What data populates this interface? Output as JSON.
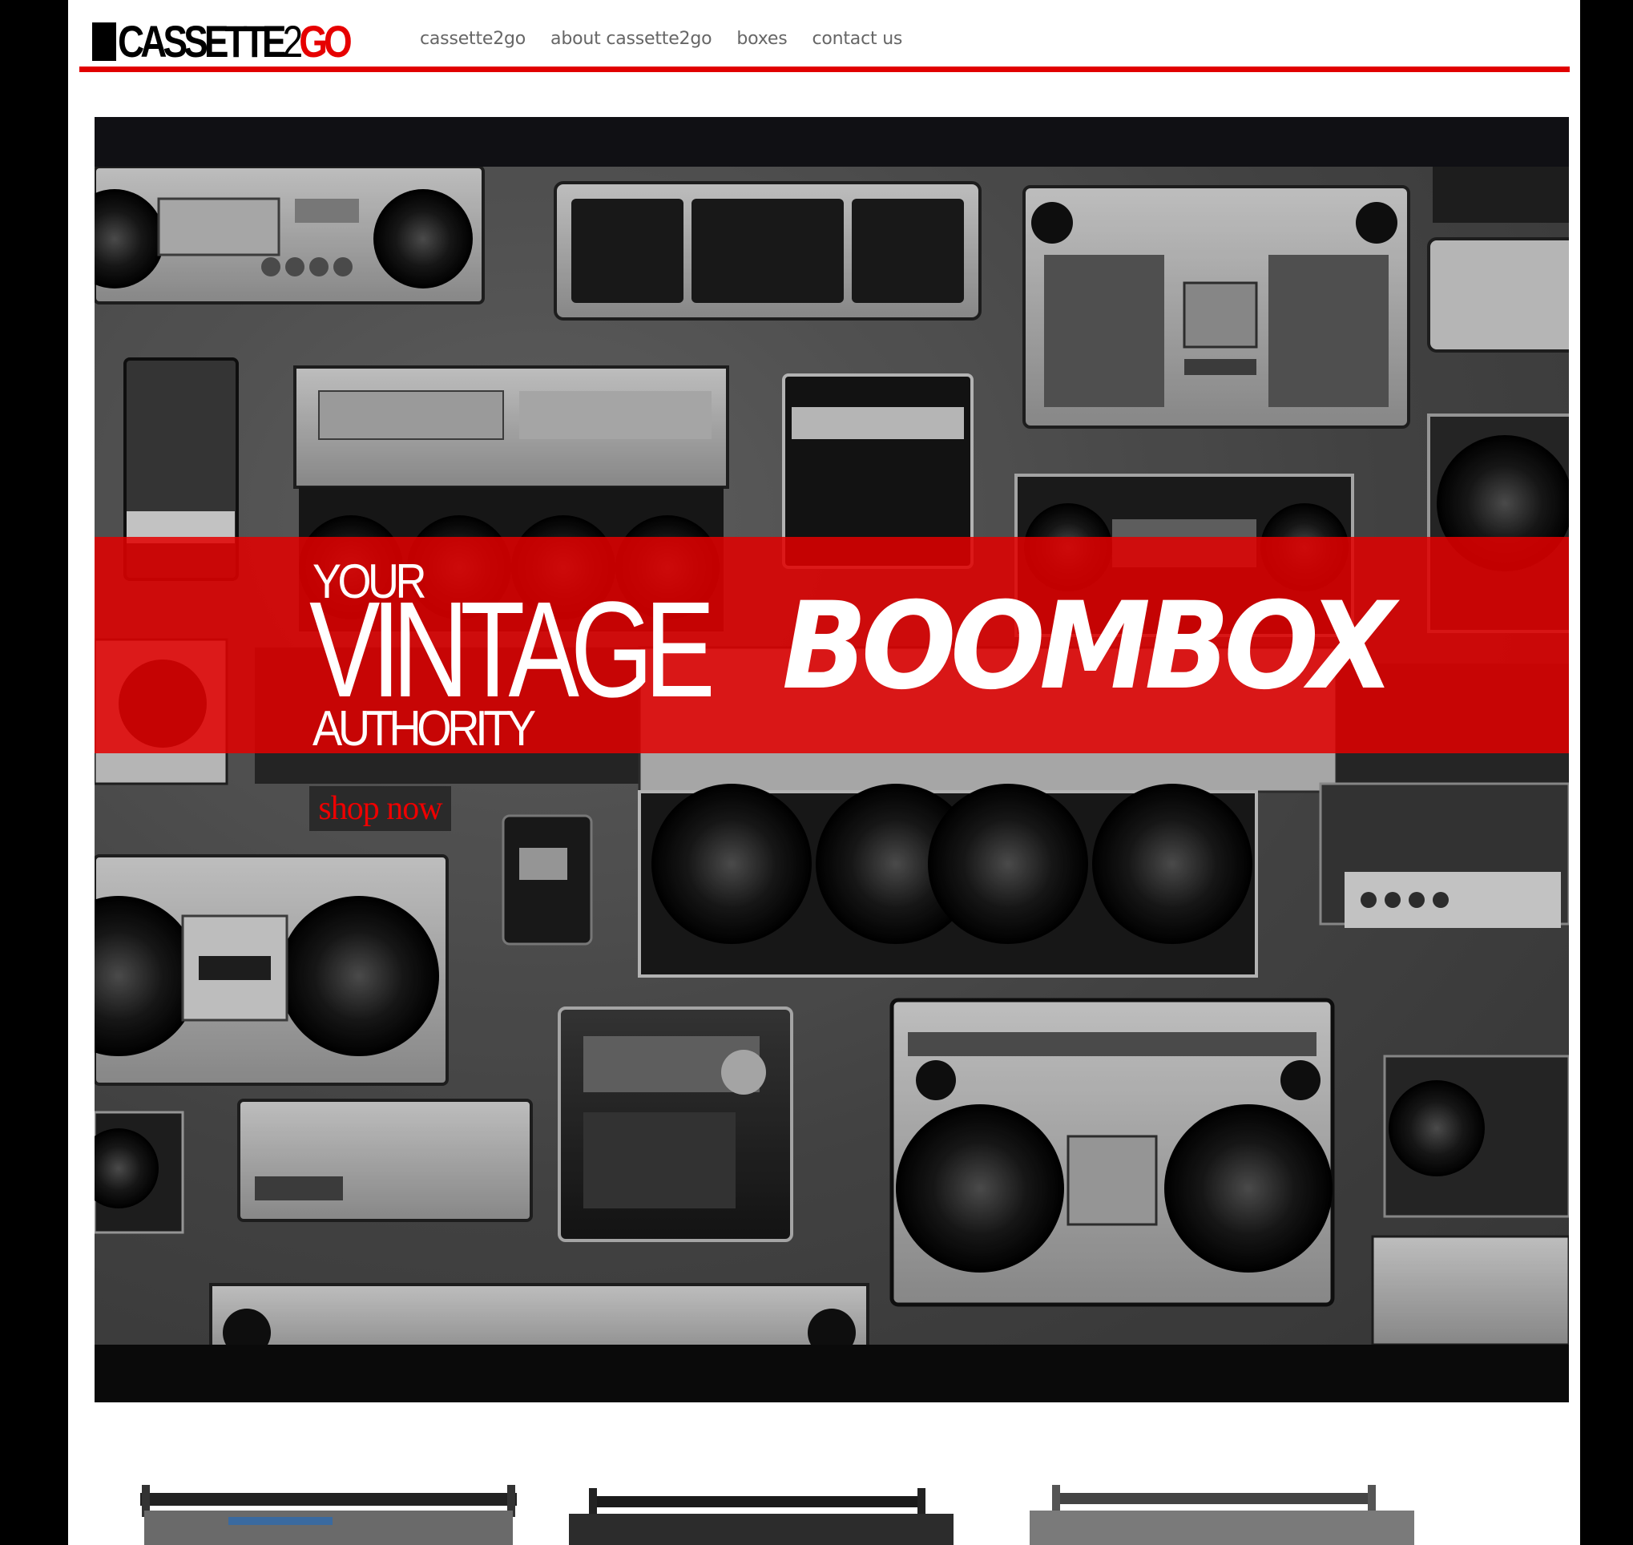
{
  "brand": {
    "logo_main": "CASSETTE",
    "logo_two": "2",
    "logo_go": "GO",
    "accent_color": "#e10000"
  },
  "nav": {
    "items": [
      {
        "label": "cassette2go"
      },
      {
        "label": "about cassette2go"
      },
      {
        "label": "boxes"
      },
      {
        "label": "contact us"
      }
    ]
  },
  "hero": {
    "line1": "YOUR",
    "line2": "VINTAGE",
    "line3": "BOOMBOX",
    "line4": "AUTHORITY",
    "cta": "shop now"
  }
}
